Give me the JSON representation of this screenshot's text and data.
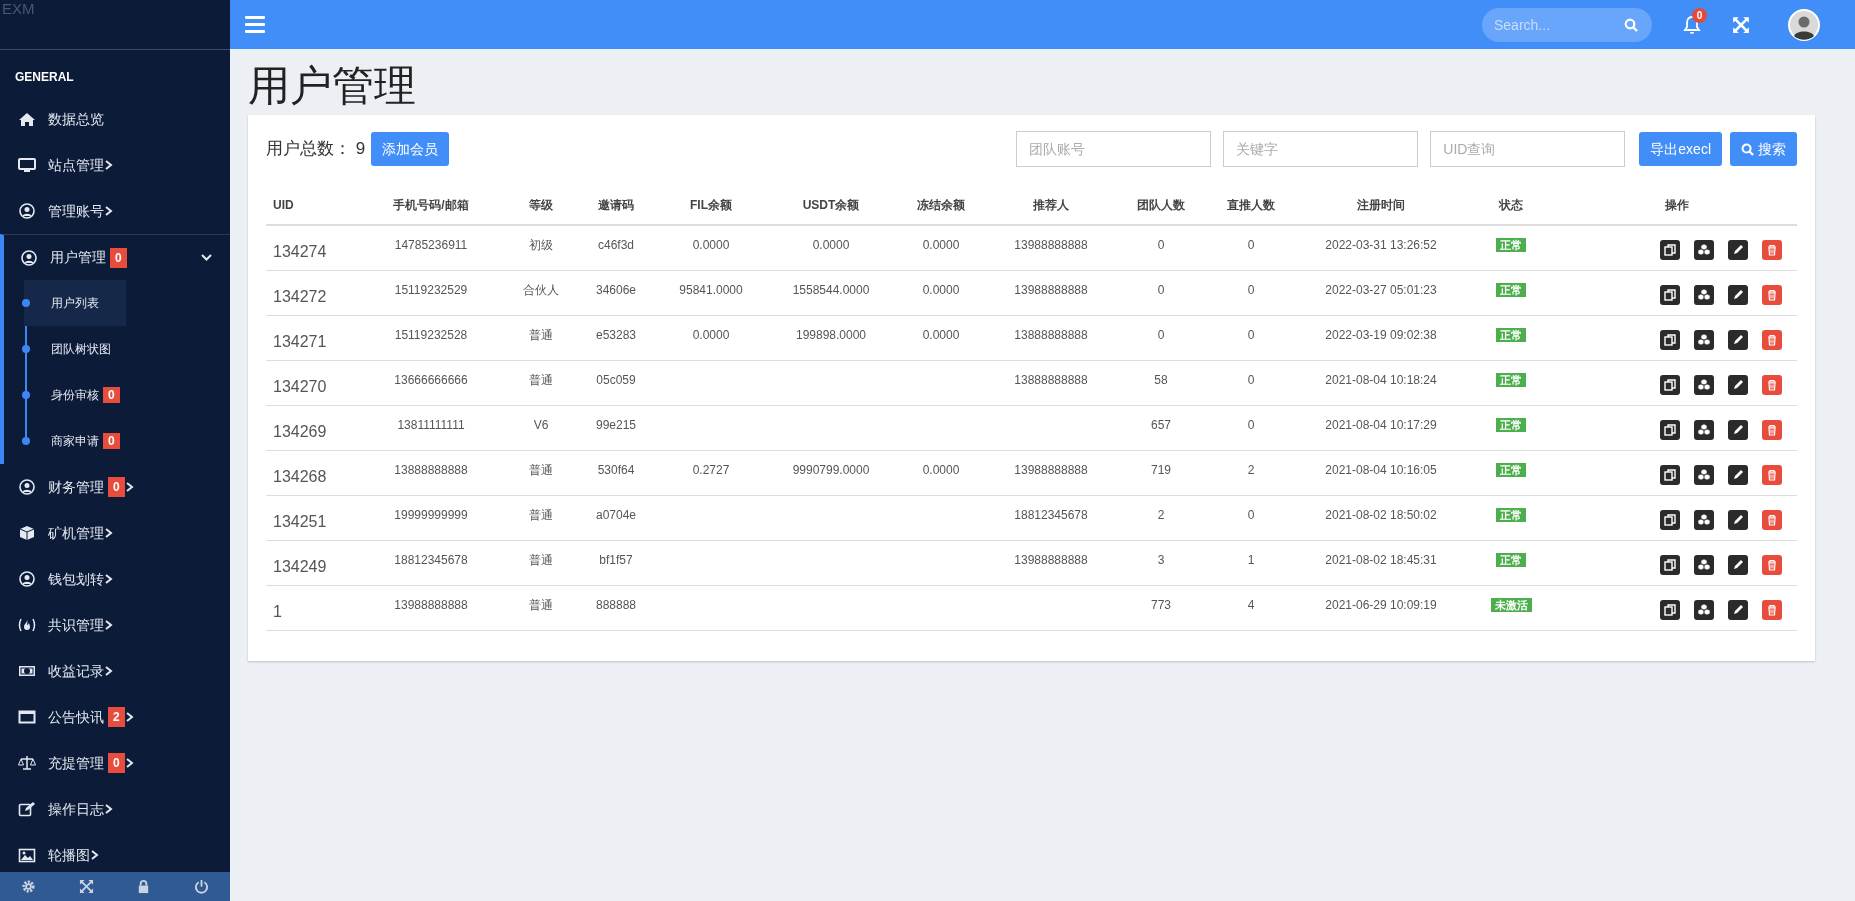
{
  "sidebar": {
    "logo": "EXM",
    "section": "GENERAL",
    "items": [
      {
        "label": "数据总览",
        "submenu": false,
        "expanded": false
      },
      {
        "label": "站点管理",
        "submenu": true,
        "expanded": false
      },
      {
        "label": "管理账号",
        "submenu": true,
        "expanded": false
      },
      {
        "label": "用户管理",
        "badge": "0",
        "submenu": true,
        "expanded": true,
        "children": [
          {
            "label": "用户列表",
            "selected": true
          },
          {
            "label": "团队树状图",
            "selected": false
          },
          {
            "label": "身份审核",
            "badge": "0",
            "selected": false
          },
          {
            "label": "商家申请",
            "badge": "0",
            "selected": false
          }
        ]
      },
      {
        "label": "财务管理",
        "badge": "0",
        "submenu": true,
        "expanded": false
      },
      {
        "label": "矿机管理",
        "submenu": true,
        "expanded": false
      },
      {
        "label": "钱包划转",
        "submenu": true,
        "expanded": false
      },
      {
        "label": "共识管理",
        "submenu": true,
        "expanded": false
      },
      {
        "label": "收益记录",
        "submenu": true,
        "expanded": false
      },
      {
        "label": "公告快讯",
        "badge": "2",
        "submenu": true,
        "expanded": false
      },
      {
        "label": "充提管理",
        "badge": "0",
        "submenu": true,
        "expanded": false
      },
      {
        "label": "操作日志",
        "submenu": true,
        "expanded": false
      },
      {
        "label": "轮播图",
        "submenu": true,
        "expanded": false
      }
    ]
  },
  "topbar": {
    "search": {
      "placeholder": "Search..."
    },
    "notifications": "0"
  },
  "page_title": "用户管理",
  "toolbar": {
    "total": "用户总数： 9",
    "add_button": "添加会员",
    "filters": [
      {
        "placeholder": "团队账号"
      },
      {
        "placeholder": "关键字"
      },
      {
        "placeholder": "UID查询"
      }
    ],
    "buttons": [
      "导出execl",
      "搜索"
    ]
  },
  "table": {
    "columns": [
      "UID",
      "手机号码/邮箱",
      "等级",
      "邀请码",
      "FIL余额",
      "USDT余额",
      "冻结余额",
      "推荐人",
      "团队人数",
      "直推人数",
      "注册时间",
      "状态",
      "操作"
    ],
    "rows": [
      {
        "uid": "134274",
        "phone": "14785236911",
        "level": "初级",
        "invite": "c46f3d",
        "fil": "0.0000",
        "usdt": "0.0000",
        "frozen": "0.0000",
        "referrer": "13988888888",
        "team": "0",
        "direct": "0",
        "registered": "2022-03-31 13:26:52",
        "status": "正常"
      },
      {
        "uid": "134272",
        "phone": "15119232529",
        "level": "合伙人",
        "invite": "34606e",
        "fil": "95841.0000",
        "usdt": "1558544.0000",
        "frozen": "0.0000",
        "referrer": "13988888888",
        "team": "0",
        "direct": "0",
        "registered": "2022-03-27 05:01:23",
        "status": "正常"
      },
      {
        "uid": "134271",
        "phone": "15119232528",
        "level": "普通",
        "invite": "e53283",
        "fil": "0.0000",
        "usdt": "199898.0000",
        "frozen": "0.0000",
        "referrer": "13888888888",
        "team": "0",
        "direct": "0",
        "registered": "2022-03-19 09:02:38",
        "status": "正常"
      },
      {
        "uid": "134270",
        "phone": "13666666666",
        "level": "普通",
        "invite": "05c059",
        "referrer": "13888888888",
        "team": "58",
        "direct": "0",
        "registered": "2021-08-04 10:18:24",
        "status": "正常"
      },
      {
        "uid": "134269",
        "phone": "13811111111",
        "level": "V6",
        "invite": "99e215",
        "team": "657",
        "direct": "0",
        "registered": "2021-08-04 10:17:29",
        "status": "正常"
      },
      {
        "uid": "134268",
        "phone": "13888888888",
        "level": "普通",
        "invite": "530f64",
        "fil": "0.2727",
        "usdt": "9990799.0000",
        "frozen": "0.0000",
        "referrer": "13988888888",
        "team": "719",
        "direct": "2",
        "registered": "2021-08-04 10:16:05",
        "status": "正常"
      },
      {
        "uid": "134251",
        "phone": "19999999999",
        "level": "普通",
        "invite": "a0704e",
        "referrer": "18812345678",
        "team": "2",
        "direct": "0",
        "registered": "2021-08-02 18:50:02",
        "status": "正常"
      },
      {
        "uid": "134249",
        "phone": "18812345678",
        "level": "普通",
        "invite": "bf1f57",
        "referrer": "13988888888",
        "team": "3",
        "direct": "1",
        "registered": "2021-08-02 18:45:31",
        "status": "正常"
      },
      {
        "uid": "1",
        "phone": "13988888888",
        "level": "普通",
        "invite": "888888",
        "team": "773",
        "direct": "4",
        "registered": "2021-06-29 10:09:19",
        "status": "未激活"
      }
    ]
  }
}
